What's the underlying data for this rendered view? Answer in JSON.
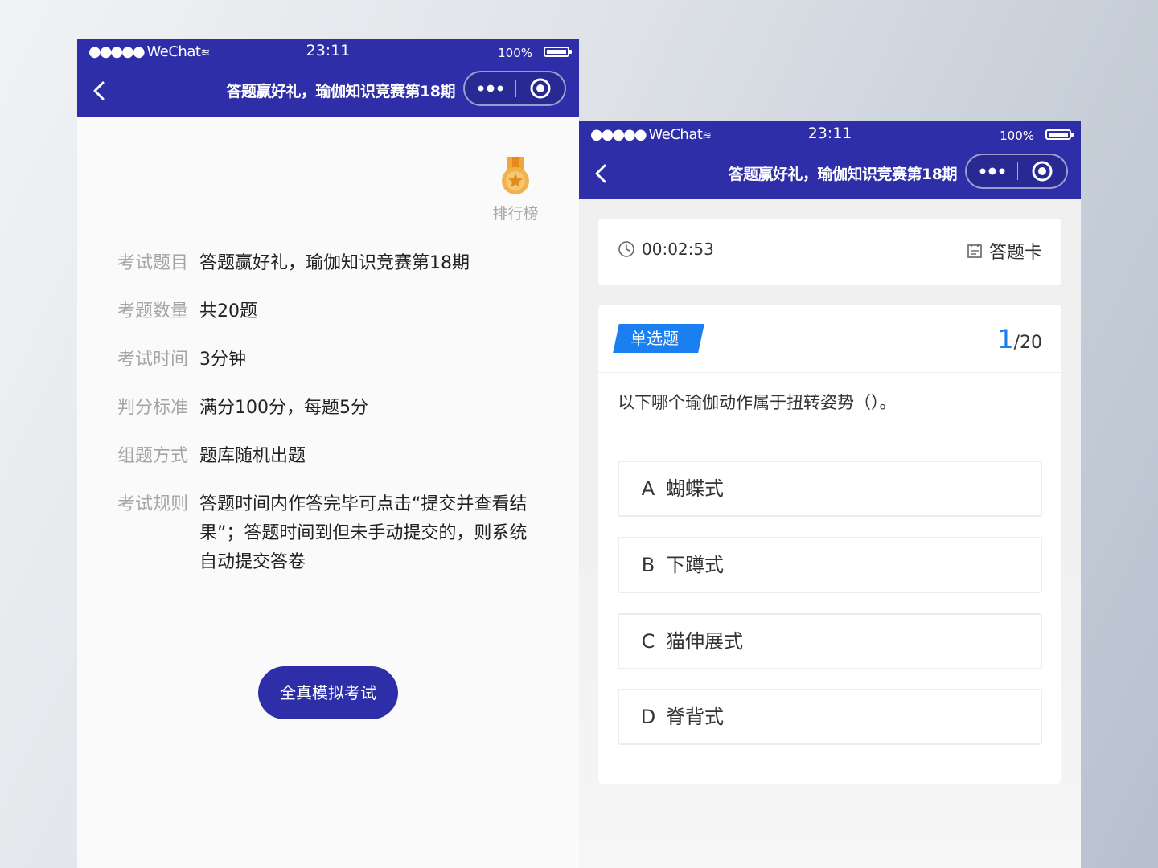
{
  "status_bar": {
    "carrier": "WeChat",
    "time": "23:11",
    "battery": "100%"
  },
  "nav": {
    "title": "答题赢好礼，瑜伽知识竞赛第18期"
  },
  "intro": {
    "leaderboard_label": "排行榜",
    "rows": [
      {
        "label": "考试题目",
        "value": "答题赢好礼，瑜伽知识竞赛第18期"
      },
      {
        "label": "考题数量",
        "value": "共20题"
      },
      {
        "label": "考试时间",
        "value": "3分钟"
      },
      {
        "label": "判分标准",
        "value": "满分100分，每题5分"
      },
      {
        "label": "组题方式",
        "value": "题库随机出题"
      },
      {
        "label": "考试规则",
        "value": "答题时间内作答完毕可点击“提交并查看结果”；答题时间到但未手动提交的，则系统自动提交答卷"
      }
    ],
    "start_button": "全真模拟考试"
  },
  "quiz": {
    "timer": "00:02:53",
    "answer_card_label": "答题卡",
    "question_type": "单选题",
    "current": "1",
    "total": "/20",
    "question": "以下哪个瑜伽动作属于扭转姿势（）。",
    "options": [
      {
        "letter": "A",
        "text": "蝴蝶式"
      },
      {
        "letter": "B",
        "text": "下蹲式"
      },
      {
        "letter": "C",
        "text": "猫伸展式"
      },
      {
        "letter": "D",
        "text": "脊背式"
      }
    ]
  },
  "colors": {
    "brand": "#2e2fa8",
    "accent": "#1a7ff0"
  }
}
